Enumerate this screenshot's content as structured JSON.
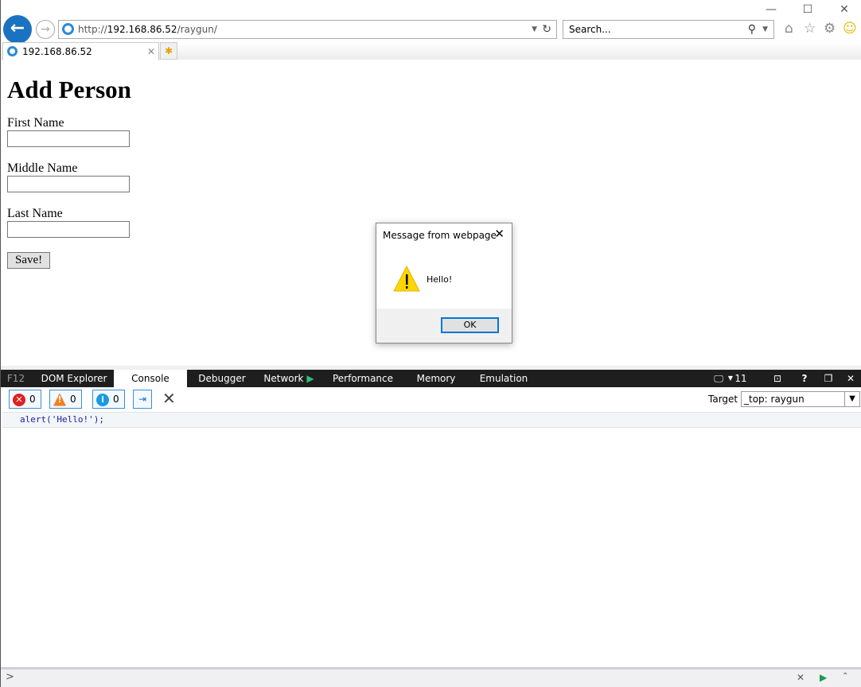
{
  "browser": {
    "url_prefix": "http://",
    "url_host": "192.168.86.52",
    "url_path": "/raygun/",
    "search_placeholder": "Search...",
    "tab_title": "192.168.86.52",
    "window_controls": {
      "minimize": "—",
      "maximize": "☐",
      "close": "✕"
    }
  },
  "page": {
    "title": "Add Person",
    "fields": [
      {
        "label": "First Name",
        "value": ""
      },
      {
        "label": "Middle Name",
        "value": ""
      },
      {
        "label": "Last Name",
        "value": ""
      }
    ],
    "save_label": "Save!"
  },
  "dialog": {
    "title": "Message from webpage",
    "message": "Hello!",
    "ok_label": "OK",
    "icon": "warning-icon"
  },
  "devtools": {
    "f12": "F12",
    "tabs": [
      "DOM Explorer",
      "Console",
      "Debugger",
      "Network",
      "Performance",
      "Memory",
      "Emulation"
    ],
    "active_tab": "Console",
    "doc_mode": "11",
    "errors": "0",
    "warnings": "0",
    "info": "0",
    "target_label": "Target",
    "target_value": "_top: raygun",
    "console_lines": [
      "alert('Hello!');"
    ],
    "prompt": ">"
  },
  "colors": {
    "accent": "#0078d7",
    "devbar": "#1e1e1e",
    "console_text": "#1a1aa6"
  }
}
